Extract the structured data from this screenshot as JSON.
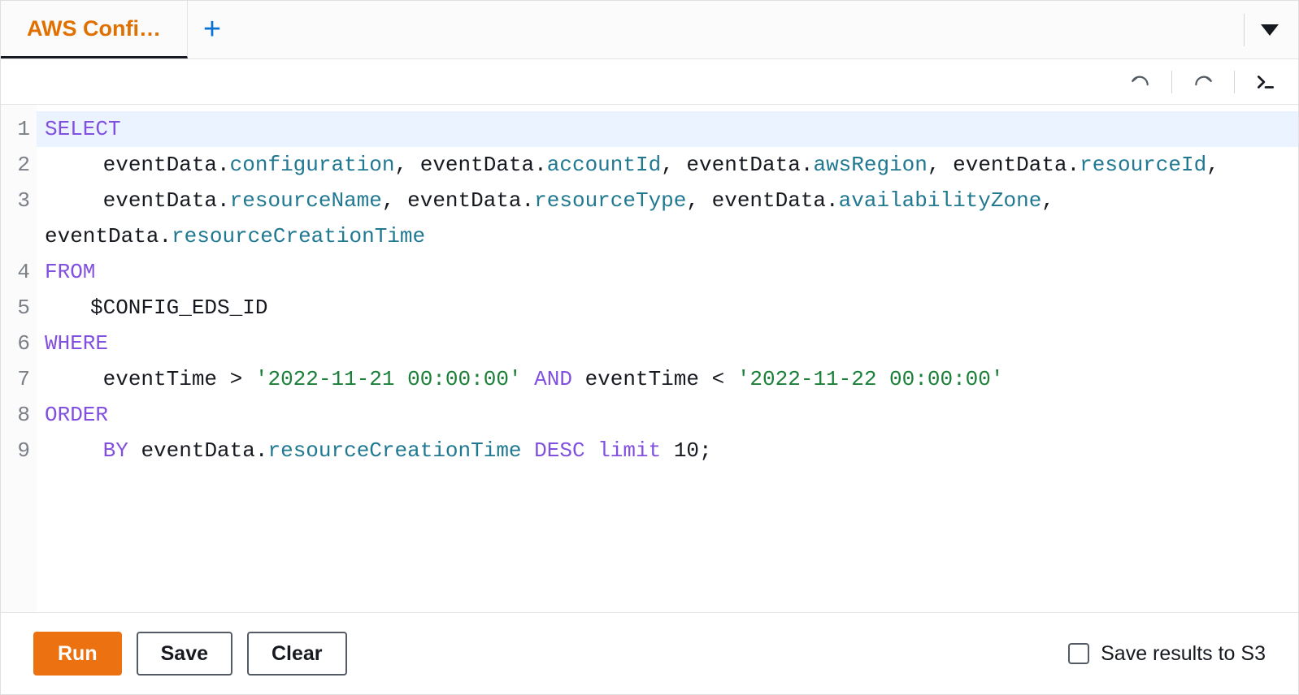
{
  "tabs": {
    "active_label": "AWS Confi…"
  },
  "toolbar": {
    "undo": "undo",
    "redo": "redo",
    "format": "format"
  },
  "editor": {
    "line_numbers": [
      "1",
      "2",
      "3",
      "4",
      "5",
      "6",
      "7",
      "8",
      "9"
    ],
    "sql": {
      "select": "SELECT",
      "from": "FROM",
      "where": "WHERE",
      "order": "ORDER",
      "by": "BY",
      "and": "AND",
      "desc": "DESC",
      "limit": "limit",
      "obj": "eventData",
      "dot": ".",
      "comma": ",",
      "semi": ";",
      "gt": ">",
      "lt": "<",
      "fields": {
        "configuration": "configuration",
        "accountId": "accountId",
        "awsRegion": "awsRegion",
        "resourceId": "resourceId",
        "resourceName": "resourceName",
        "resourceType": "resourceType",
        "availabilityZone": "availabilityZone",
        "resourceCreationTime": "resourceCreationTime"
      },
      "table": "$CONFIG_EDS_ID",
      "eventTime": "eventTime",
      "ts1": "'2022-11-21 00:00:00'",
      "ts2": "'2022-11-22 00:00:00'",
      "limitNum": "10"
    }
  },
  "footer": {
    "run": "Run",
    "save": "Save",
    "clear": "Clear",
    "save_to_s3": "Save results to S3",
    "save_to_s3_checked": false
  }
}
